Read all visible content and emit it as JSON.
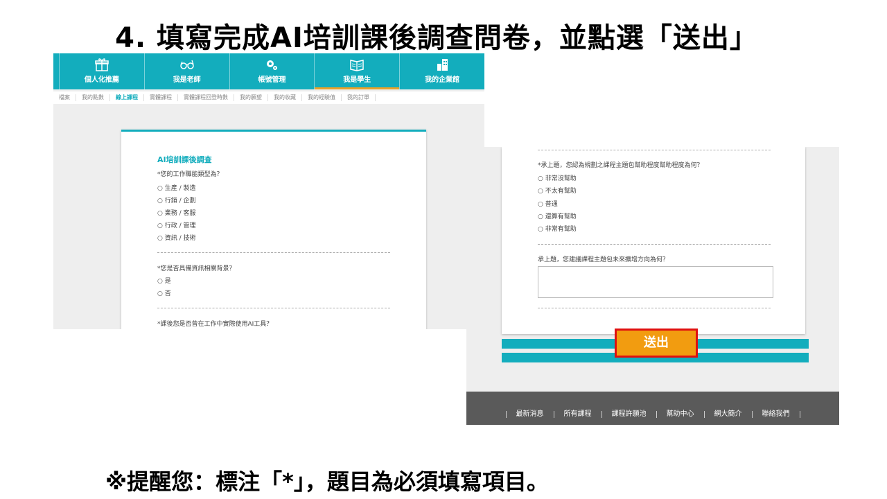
{
  "slide": {
    "title": "4. 填寫完成AI培訓課後調查問卷，並點選「送出」",
    "reminder": "※提醒您：標注「*」，題目為必須填寫項目。"
  },
  "colors": {
    "accent": "#13adbd",
    "submit": "#f29c10",
    "highlight_border": "#e01010",
    "footer": "#5a5a5a"
  },
  "topnav": {
    "items": [
      {
        "label": "個人化推薦",
        "icon": "gift-icon"
      },
      {
        "label": "我是老師",
        "icon": "glasses-icon"
      },
      {
        "label": "帳號管理",
        "icon": "gears-icon"
      },
      {
        "label": "我是學生",
        "icon": "book-icon",
        "active": true
      },
      {
        "label": "我的企業館",
        "icon": "building-icon"
      }
    ]
  },
  "subnav": [
    "檔案",
    "我的點數",
    "線上課程",
    "實體課程",
    "實體課程回登時數",
    "我的願望",
    "我的收藏",
    "我的經驗值",
    "我的訂單"
  ],
  "subnav_active": "線上課程",
  "survey": {
    "title": "AI培訓課後調查",
    "q1": "*您的工作職能類型為？",
    "q1_options": [
      "○ 生產 / 製造",
      "○ 行銷 / 企劃",
      "○ 業務 / 客服",
      "○ 行政 / 管理",
      "○ 資訊 / 技術"
    ],
    "q2": "*您是否具備資訊相關背景？",
    "q2_options": [
      "○ 是",
      "○ 否"
    ],
    "q3": "*課後您是否曾在工作中實際使用AI工具？"
  },
  "survey_right": {
    "q4": "*承上題，您認為規劃之課程主題包幫助程度幫助程度為何？",
    "q4_options": [
      "○ 非常沒幫助",
      "○ 不太有幫助",
      "○ 普通",
      "○ 還算有幫助",
      "○ 非常有幫助"
    ],
    "q5": "承上題，您建議課程主題包未來擴增方向為何？",
    "textarea_value": "",
    "submit_label": "送出"
  },
  "footer": {
    "links": [
      "最新消息",
      "所有課程",
      "課程許願池",
      "幫助中心",
      "網大簡介",
      "聯絡我們"
    ]
  }
}
